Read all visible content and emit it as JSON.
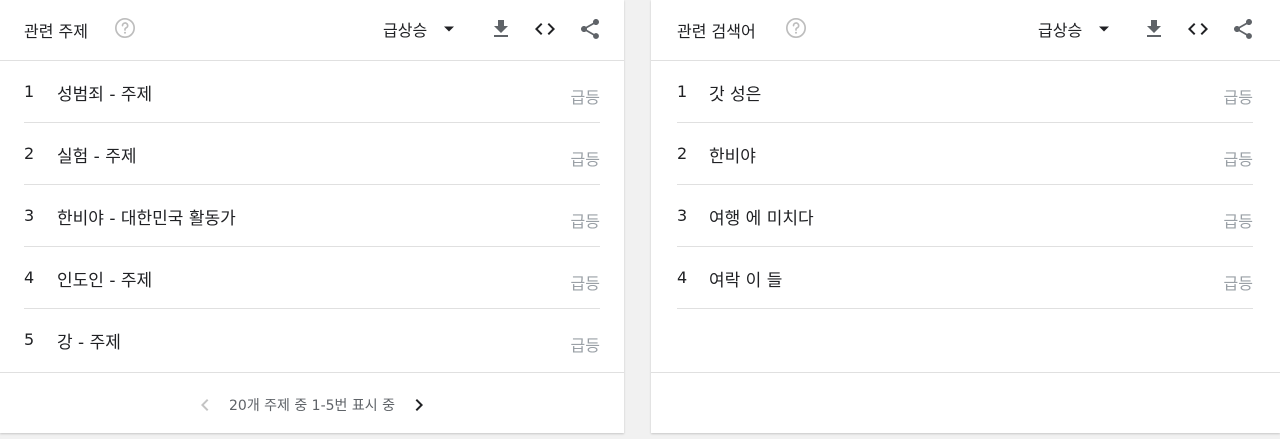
{
  "left_card": {
    "title": "관련 주제",
    "sort_selected": "급상승",
    "items": [
      {
        "rank": "1",
        "label": "성범죄 - 주제",
        "value": "급등"
      },
      {
        "rank": "2",
        "label": "실험 - 주제",
        "value": "급등"
      },
      {
        "rank": "3",
        "label": "한비야 - 대한민국 활동가",
        "value": "급등"
      },
      {
        "rank": "4",
        "label": "인도인 - 주제",
        "value": "급등"
      },
      {
        "rank": "5",
        "label": "강 - 주제",
        "value": "급등"
      }
    ],
    "pagination_text": "20개 주제 중 1-5번 표시 중"
  },
  "right_card": {
    "title": "관련 검색어",
    "sort_selected": "급상승",
    "items": [
      {
        "rank": "1",
        "label": "갓 성은",
        "value": "급등"
      },
      {
        "rank": "2",
        "label": "한비야",
        "value": "급등"
      },
      {
        "rank": "3",
        "label": "여행 에 미치다",
        "value": "급등"
      },
      {
        "rank": "4",
        "label": "여락 이 들",
        "value": "급등"
      }
    ]
  },
  "icons": {
    "help": "help-circle-icon",
    "dropdown": "dropdown-arrow-icon",
    "download": "download-icon",
    "embed": "code-embed-icon",
    "share": "share-icon",
    "prev": "chevron-left-icon",
    "next": "chevron-right-icon"
  },
  "colors": {
    "icon": "#5f6368",
    "muted_value": "#9aa0a6",
    "divider": "#e0e0e0",
    "background": "#f1f1f1"
  }
}
